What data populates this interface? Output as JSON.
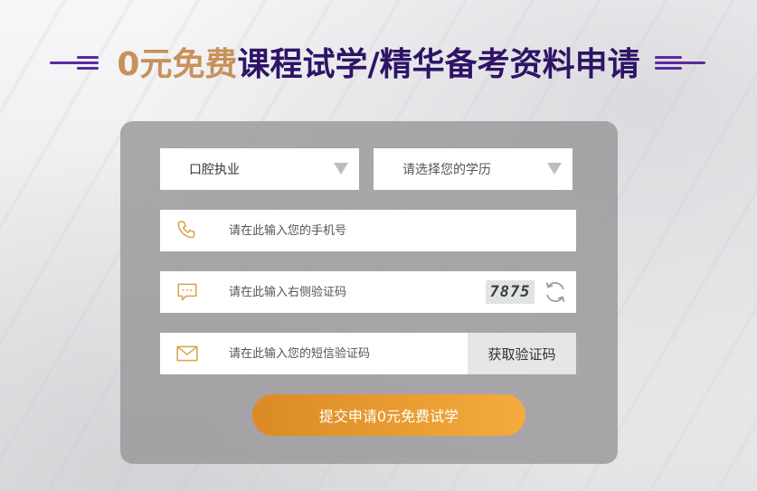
{
  "heading": {
    "title_highlight": "0元免费",
    "title_main": "课程试学/精华备考资料申请"
  },
  "form": {
    "profession_select": {
      "selected": "口腔执业"
    },
    "education_select": {
      "selected": "请选择您的学历"
    },
    "phone_input": {
      "placeholder": "请在此输入您的手机号"
    },
    "captcha_input": {
      "placeholder": "请在此输入右侧验证码",
      "captcha_text": "7875"
    },
    "sms_input": {
      "placeholder": "请在此输入您的短信验证码"
    },
    "sms_button_label": "获取验证码",
    "submit_label": "提交申请0元免费试学"
  },
  "icons": {
    "phone": "phone-icon",
    "message": "message-icon",
    "mail": "mail-icon",
    "refresh": "refresh-icon",
    "dropdown": "chevron-down-icon"
  },
  "colors": {
    "gold": "#c7915a",
    "purple": "#2e1466",
    "accent_line": "#5b2aa0",
    "icon": "#d8a24a",
    "button_start": "#db8a25",
    "button_end": "#f4ab3d"
  }
}
